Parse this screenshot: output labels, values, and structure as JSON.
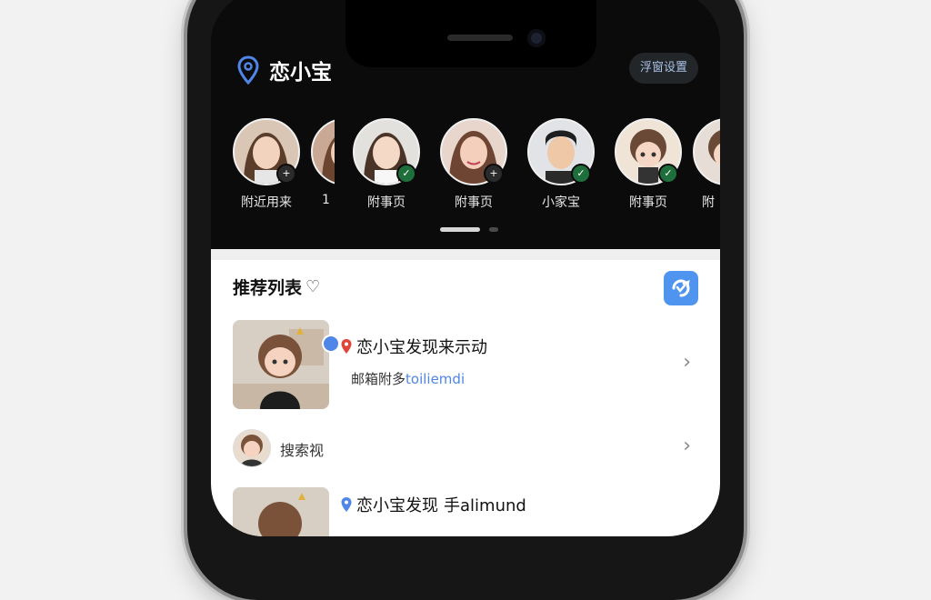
{
  "app": {
    "title": "恋小宝",
    "top_button_label": "浮窗设置"
  },
  "stories": [
    {
      "name": "附近用来",
      "badge": "+",
      "badge_color": "#2b2b2b"
    },
    {
      "name": "1",
      "badge": "",
      "badge_color": ""
    },
    {
      "name": "附事页",
      "badge": "✓",
      "badge_color": "#1f6f3c"
    },
    {
      "name": "附事页",
      "badge": "+",
      "badge_color": "#2b2b2b"
    },
    {
      "name": "小家宝",
      "badge": "✓",
      "badge_color": "#1f6f3c"
    },
    {
      "name": "附事页",
      "badge": "✓",
      "badge_color": "#1f6f3c"
    },
    {
      "name": "附",
      "badge": "",
      "badge_color": ""
    }
  ],
  "section": {
    "title": "推荐列表",
    "heart": "♡"
  },
  "items": [
    {
      "title": "恋小宝发现来示动",
      "sub_prefix": "邮箱附多",
      "sub_accent": "toiliemdi",
      "chevron": "›"
    },
    {
      "title": "搜索视",
      "chevron": "›"
    },
    {
      "title": "恋小宝发现",
      "title_suffix": "手alimund"
    }
  ],
  "colors": {
    "accent": "#4f95f0",
    "location_pin": "#4f86e8",
    "item_pin": "#e0453a"
  }
}
